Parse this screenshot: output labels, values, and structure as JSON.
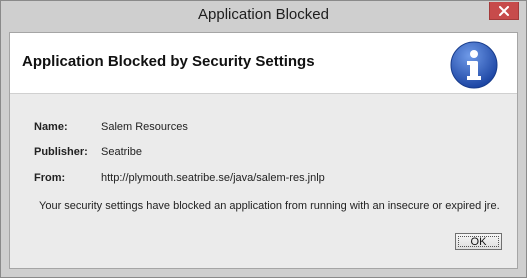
{
  "window": {
    "title": "Application Blocked",
    "close_icon": "close-icon",
    "close_color": "#c74b4b"
  },
  "header": {
    "title": "Application Blocked by Security Settings",
    "icon": "info-icon",
    "icon_color": "#2b56b8"
  },
  "details": {
    "name_label": "Name:",
    "name_value": "Salem Resources",
    "publisher_label": "Publisher:",
    "publisher_value": "Seatribe",
    "from_label": "From:",
    "from_value": "http://plymouth.seatribe.se/java/salem-res.jnlp"
  },
  "message": "Your security settings have blocked an application from running with an insecure or expired jre.",
  "buttons": {
    "ok_label": "OK"
  }
}
